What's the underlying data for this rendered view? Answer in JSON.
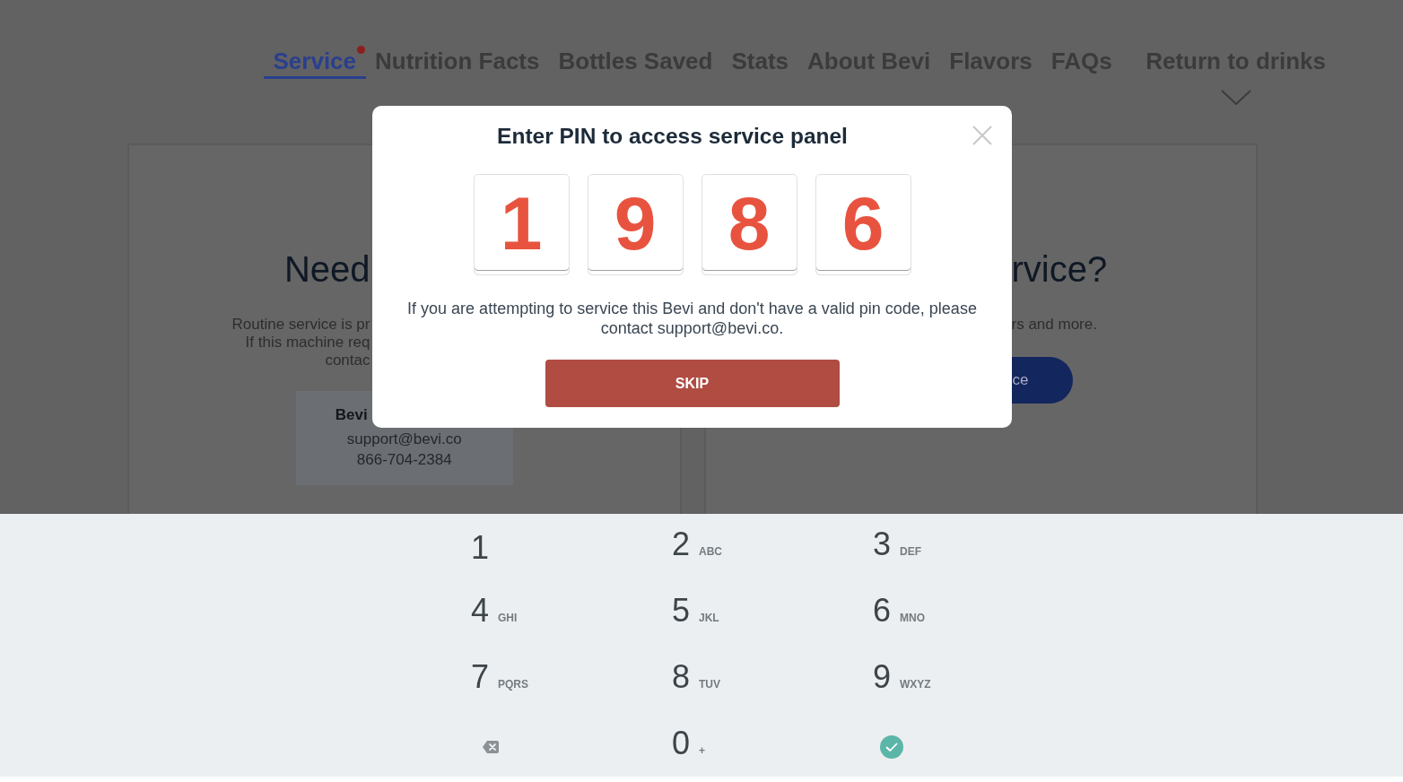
{
  "nav": {
    "tabs": [
      {
        "label": "Service",
        "selected": true,
        "notification_dot": true
      },
      {
        "label": "Nutrition Facts",
        "selected": false,
        "notification_dot": false
      },
      {
        "label": "Bottles Saved",
        "selected": false,
        "notification_dot": false
      },
      {
        "label": "Stats",
        "selected": false,
        "notification_dot": false
      },
      {
        "label": "About Bevi",
        "selected": false,
        "notification_dot": false
      },
      {
        "label": "Flavors",
        "selected": false,
        "notification_dot": false
      },
      {
        "label": "FAQs",
        "selected": false,
        "notification_dot": false
      }
    ],
    "return_link": {
      "label": "Return to drinks"
    }
  },
  "left_card": {
    "heading": "Need",
    "text_lines": [
      "Routine service is pr",
      "If this machine req",
      "contac"
    ],
    "contact": {
      "name": "Bevi",
      "email": "support@bevi.co",
      "phone": "866-704-2384"
    }
  },
  "right_card": {
    "heading": "rvice?",
    "text_lines": [
      "rs and more."
    ],
    "button": {
      "label": "ce"
    }
  },
  "pin_dialog": {
    "title": "Enter PIN to access service panel",
    "digits": [
      "1",
      "9",
      "8",
      "6"
    ],
    "message": "If you are attempting to service this Bevi and don't have a valid pin code, please contact support@bevi.co.",
    "skip_button": {
      "label": "SKIP"
    }
  },
  "keypad": {
    "keys": [
      {
        "kind": "digit",
        "digit": "1"
      },
      {
        "kind": "digit",
        "digit": "2",
        "letters": "ABC"
      },
      {
        "kind": "digit",
        "digit": "3",
        "letters": "DEF"
      },
      {
        "kind": "digit",
        "digit": "4",
        "letters": "GHI"
      },
      {
        "kind": "digit",
        "digit": "5",
        "letters": "JKL"
      },
      {
        "kind": "digit",
        "digit": "6",
        "letters": "MNO"
      },
      {
        "kind": "digit",
        "digit": "7",
        "letters": "PQRS"
      },
      {
        "kind": "digit",
        "digit": "8",
        "letters": "TUV"
      },
      {
        "kind": "digit",
        "digit": "9",
        "letters": "WXYZ"
      },
      {
        "kind": "backspace"
      },
      {
        "kind": "digit",
        "digit": "0",
        "letters": "+"
      },
      {
        "kind": "confirm"
      }
    ]
  }
}
